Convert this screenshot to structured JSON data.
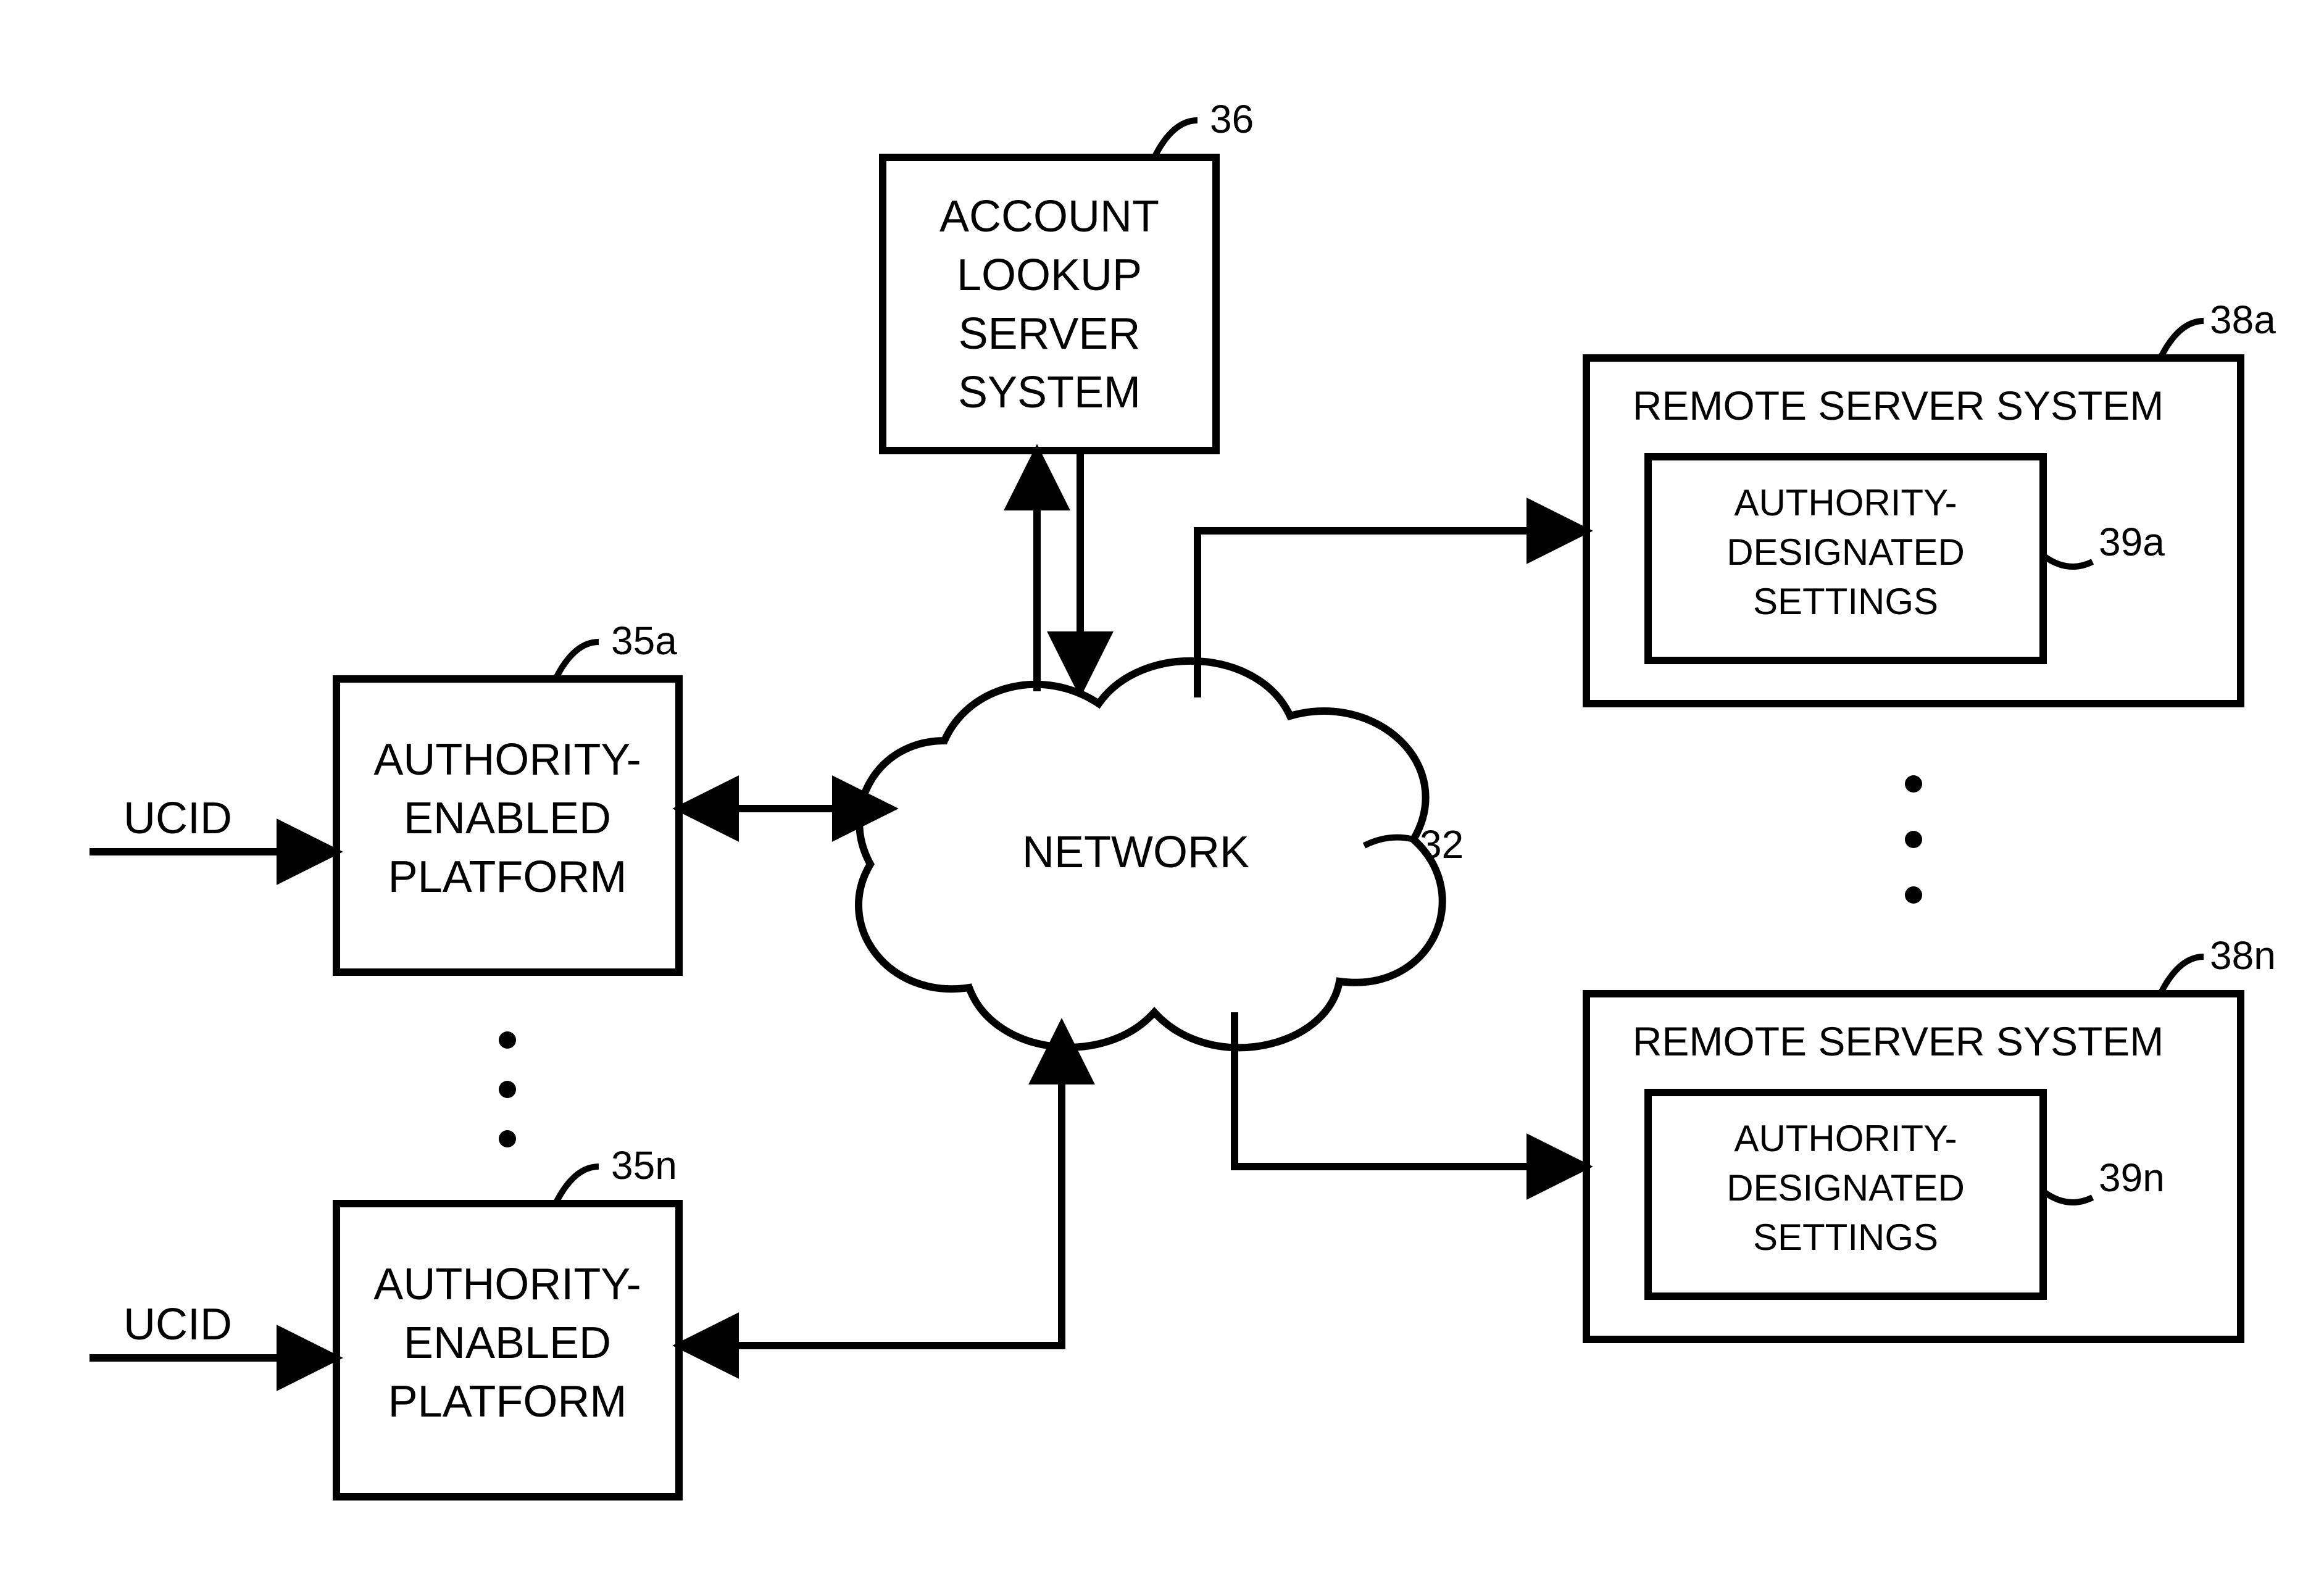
{
  "nodes": {
    "account_lookup": {
      "label_lines": [
        "ACCOUNT",
        "LOOKUP",
        "SERVER",
        "SYSTEM"
      ],
      "ref": "36"
    },
    "network": {
      "label": "NETWORK",
      "ref": "32"
    },
    "platform_a": {
      "label_lines": [
        "AUTHORITY-",
        "ENABLED",
        "PLATFORM"
      ],
      "ref": "35a",
      "input_label": "UCID"
    },
    "platform_n": {
      "label_lines": [
        "AUTHORITY-",
        "ENABLED",
        "PLATFORM"
      ],
      "ref": "35n",
      "input_label": "UCID"
    },
    "remote_a": {
      "title": "REMOTE SERVER SYSTEM",
      "ref": "38a",
      "settings": {
        "label_lines": [
          "AUTHORITY-",
          "DESIGNATED",
          "SETTINGS"
        ],
        "ref": "39a"
      }
    },
    "remote_n": {
      "title": "REMOTE SERVER SYSTEM",
      "ref": "38n",
      "settings": {
        "label_lines": [
          "AUTHORITY-",
          "DESIGNATED",
          "SETTINGS"
        ],
        "ref": "39n"
      }
    }
  }
}
